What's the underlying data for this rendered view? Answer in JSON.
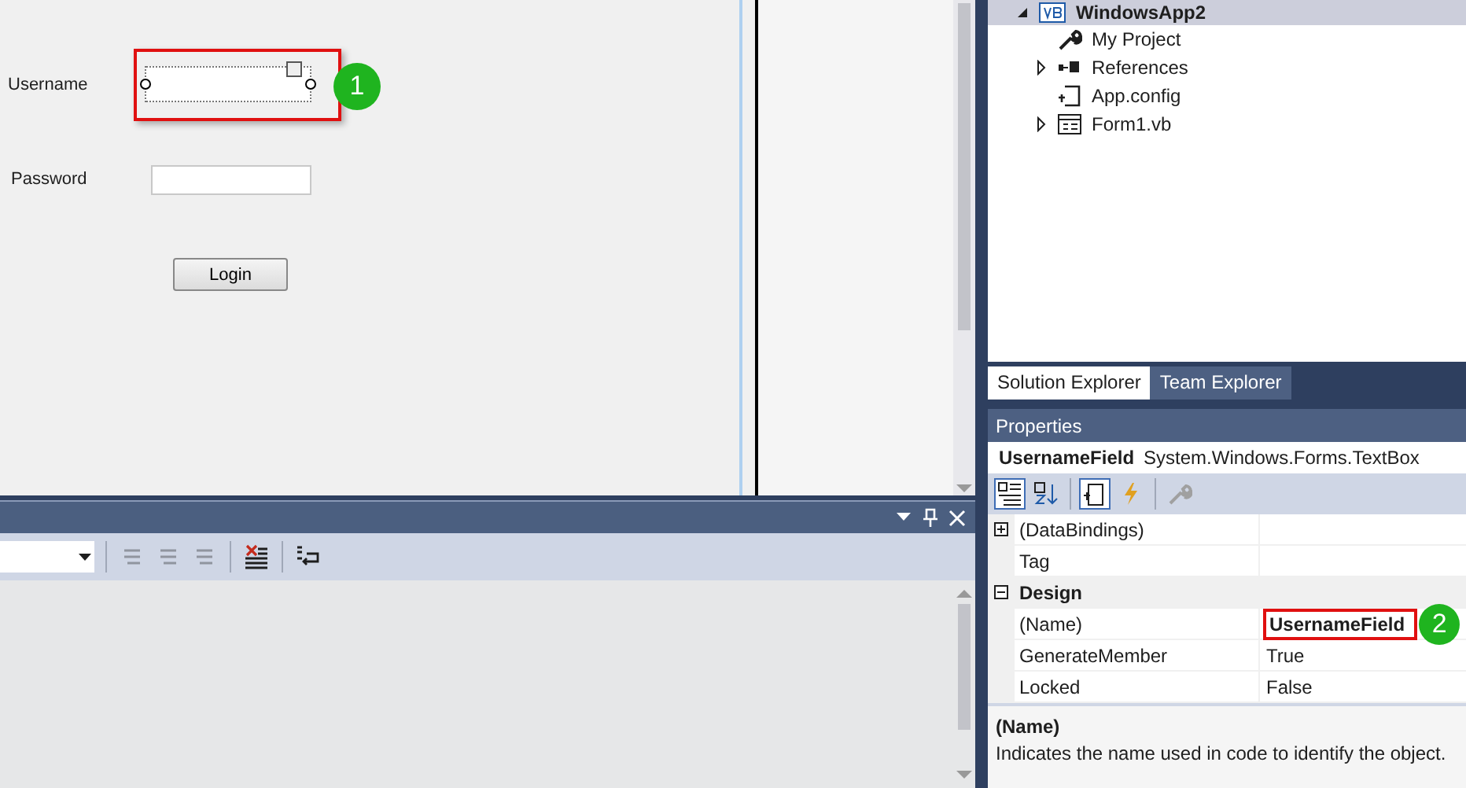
{
  "form": {
    "fields": [
      {
        "label": "Username",
        "selected": true,
        "callout": "1"
      },
      {
        "label": "Password",
        "selected": false
      }
    ],
    "button": "Login"
  },
  "output_panel": {
    "toolbar": [
      {
        "kind": "dropdown"
      },
      {
        "kind": "tool",
        "disabled": true
      },
      {
        "kind": "tool",
        "disabled": true
      },
      {
        "kind": "tool",
        "disabled": true
      },
      {
        "kind": "tool",
        "disabled": false
      },
      {
        "kind": "tool",
        "disabled": false
      }
    ]
  },
  "solution_explorer": {
    "tree": [
      {
        "label": "WindowsApp2",
        "kind": "project",
        "selected": true,
        "expanded": true,
        "children": [
          {
            "label": "My Project",
            "kind": "settings",
            "selected": false
          },
          {
            "label": "References",
            "kind": "references",
            "selected": false,
            "expanded": false
          },
          {
            "label": "App.config",
            "kind": "config",
            "selected": false
          },
          {
            "label": "Form1.vb",
            "kind": "form",
            "selected": false,
            "expanded": false
          }
        ]
      }
    ],
    "tabs": [
      {
        "label": "Solution Explorer",
        "selected": true
      },
      {
        "label": "Team Explorer",
        "selected": false
      }
    ]
  },
  "properties": {
    "title": "Properties",
    "object_name": "UsernameField",
    "object_type": "System.Windows.Forms.TextBox",
    "toolbar": [
      {
        "selected": true
      },
      {
        "selected": false
      },
      {
        "selected": true
      },
      {
        "selected": false
      },
      {
        "selected": false
      }
    ],
    "rows": [
      {
        "kind": "property",
        "name": "(DataBindings)",
        "value": "",
        "expanded": false
      },
      {
        "kind": "property",
        "name": "Tag",
        "value": ""
      },
      {
        "kind": "category",
        "name": "Design",
        "expanded": true
      },
      {
        "kind": "property",
        "name": "(Name)",
        "value": "UsernameField",
        "modified": true,
        "callout": "2"
      },
      {
        "kind": "property",
        "name": "GenerateMember",
        "value": "True",
        "modified": false
      },
      {
        "kind": "property",
        "name": "Locked",
        "value": "False",
        "modified": false
      }
    ],
    "description": {
      "title": "(Name)",
      "text": "Indicates the name used in code to identify the object."
    }
  }
}
